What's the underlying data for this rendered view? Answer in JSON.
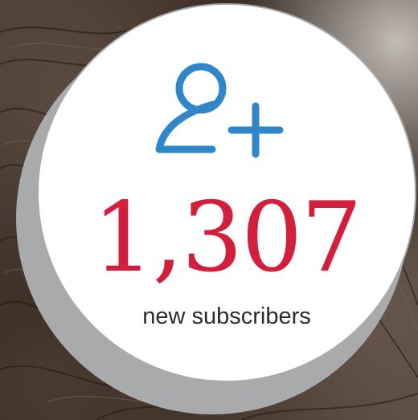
{
  "stat": {
    "count": "1,307",
    "label": "new subscribers"
  },
  "icon": {
    "name": "add-user-icon",
    "color": "#2f86c8"
  },
  "colors": {
    "count": "#d21f3c",
    "label": "#2b2b2b",
    "circle": "#ffffff",
    "circle_shadow": "#a9aaac"
  }
}
